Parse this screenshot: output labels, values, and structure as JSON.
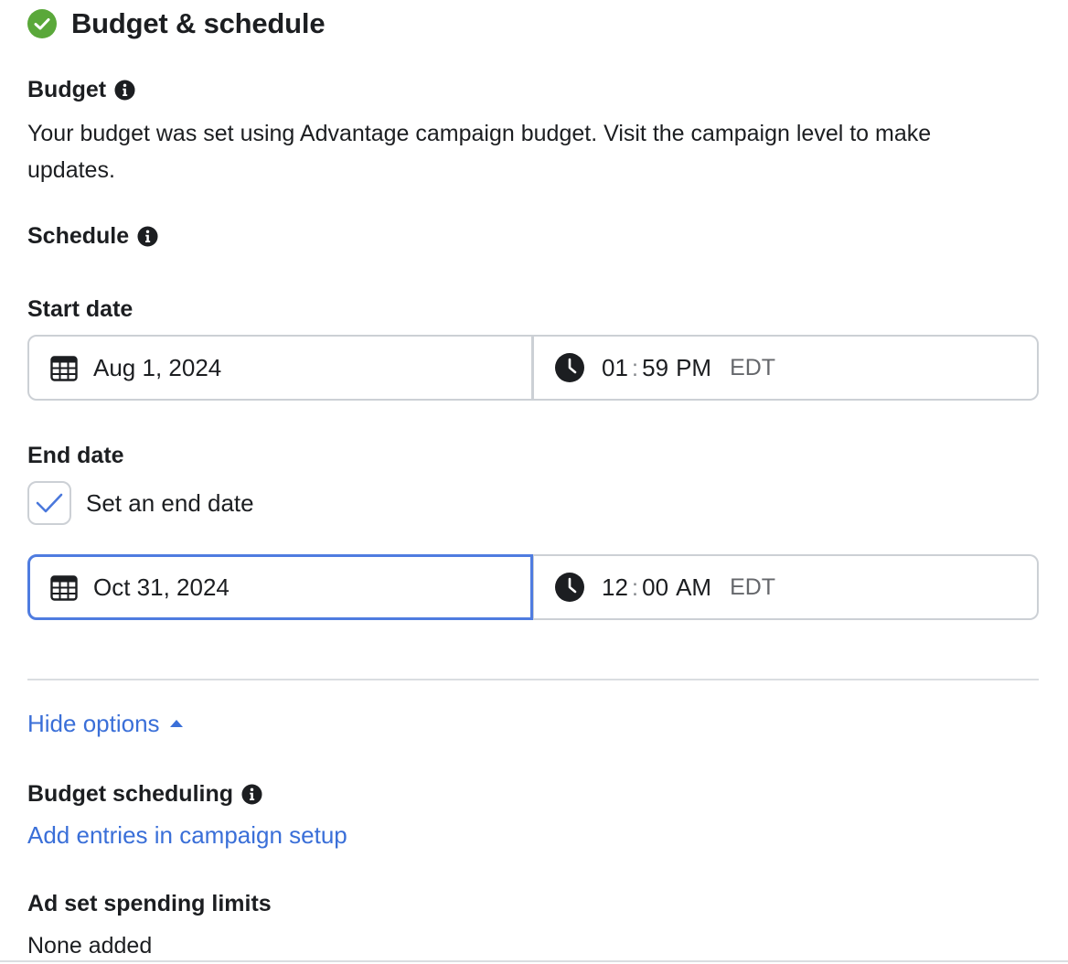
{
  "section": {
    "title": "Budget & schedule",
    "status_icon": "check-circle-icon",
    "status_color": "#5aa83a"
  },
  "budget": {
    "label": "Budget",
    "info_icon": "info-icon",
    "text": "Your budget was set using Advantage campaign budget. Visit the campaign level to make updates."
  },
  "schedule": {
    "label": "Schedule",
    "info_icon": "info-icon"
  },
  "start": {
    "label": "Start date",
    "date": "Aug 1, 2024",
    "hour": "01",
    "minute": "59",
    "ampm": "PM",
    "timezone": "EDT",
    "date_icon": "calendar-icon",
    "time_icon": "clock-icon"
  },
  "end": {
    "label": "End date",
    "checkbox_label": "Set an end date",
    "checked": true,
    "date": "Oct 31, 2024",
    "hour": "12",
    "minute": "00",
    "ampm": "AM",
    "timezone": "EDT",
    "date_icon": "calendar-icon",
    "time_icon": "clock-icon"
  },
  "options": {
    "toggle_label": "Hide options",
    "toggle_icon": "caret-up-icon"
  },
  "budget_scheduling": {
    "label": "Budget scheduling",
    "info_icon": "info-icon",
    "link": "Add entries in campaign setup"
  },
  "spending_limits": {
    "label": "Ad set spending limits",
    "value": "None added"
  },
  "colors": {
    "link": "#3a6fd8",
    "focus_border": "#4f7ce0",
    "border": "#ccd0d5",
    "text": "#1c1e21",
    "muted": "#65676b"
  }
}
